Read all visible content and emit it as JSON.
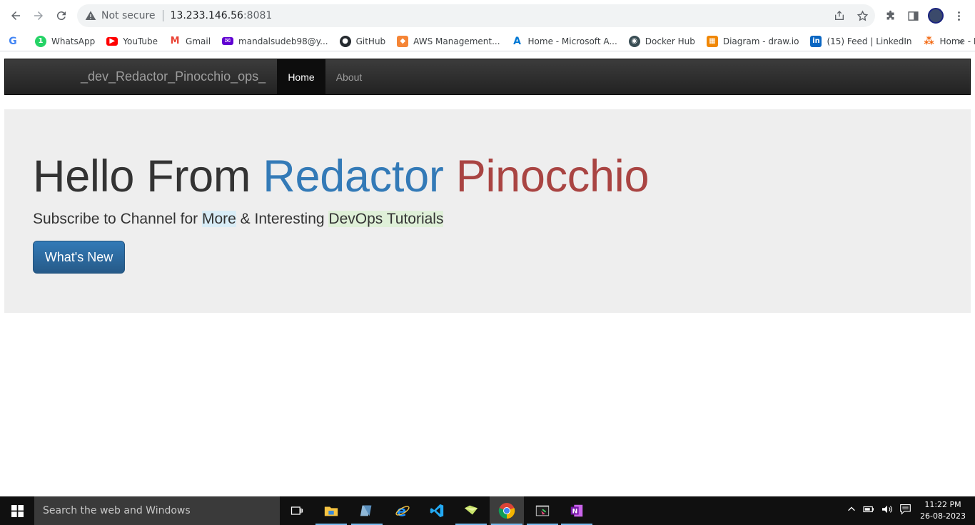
{
  "browser": {
    "security_label": "Not secure",
    "url_host": "13.233.146.56",
    "url_port": ":8081",
    "bookmarks": [
      {
        "label": "",
        "icon": "google-icon",
        "color": "#4285f4"
      },
      {
        "label": "WhatsApp",
        "icon": "whatsapp-icon",
        "color": "#25d366"
      },
      {
        "label": "YouTube",
        "icon": "youtube-icon",
        "color": "#ff0000"
      },
      {
        "label": "Gmail",
        "icon": "gmail-icon",
        "color": "#ea4335"
      },
      {
        "label": "mandalsudeb98@y...",
        "icon": "yahoo-mail-icon",
        "color": "#6001d2"
      },
      {
        "label": "GitHub",
        "icon": "github-icon",
        "color": "#24292e"
      },
      {
        "label": "AWS Management...",
        "icon": "aws-icon",
        "color": "#f58536"
      },
      {
        "label": "Home - Microsoft A...",
        "icon": "azure-icon",
        "color": "#0078d4"
      },
      {
        "label": "Docker Hub",
        "icon": "docker-icon",
        "color": "#394d54"
      },
      {
        "label": "Diagram - draw.io",
        "icon": "drawio-icon",
        "color": "#f08705"
      },
      {
        "label": "(15) Feed | LinkedIn",
        "icon": "linkedin-icon",
        "color": "#0a66c2"
      },
      {
        "label": "Home - Replit",
        "icon": "replit-icon",
        "color": "#f26207"
      }
    ],
    "bookmarks_more": "»"
  },
  "navbar": {
    "brand": "_dev_Redactor_Pinocchio_ops_",
    "home_label": "Home",
    "about_label": "About"
  },
  "hero": {
    "title_part1": "Hello From ",
    "title_part2": "Redactor",
    "title_part3": "Pinocchio",
    "subtitle_part1": "Subscribe to Channel for ",
    "subtitle_more": "More",
    "subtitle_part2": " & Interesting ",
    "subtitle_devops": "DevOps Tutorials",
    "button_label": "What's New"
  },
  "taskbar": {
    "search_placeholder": "Search the web and Windows",
    "time": "11:22 PM",
    "date": "26-08-2023"
  },
  "colors": {
    "brand_blue": "#337ab7",
    "brand_red": "#a94442",
    "navbar_dark": "#222222"
  }
}
